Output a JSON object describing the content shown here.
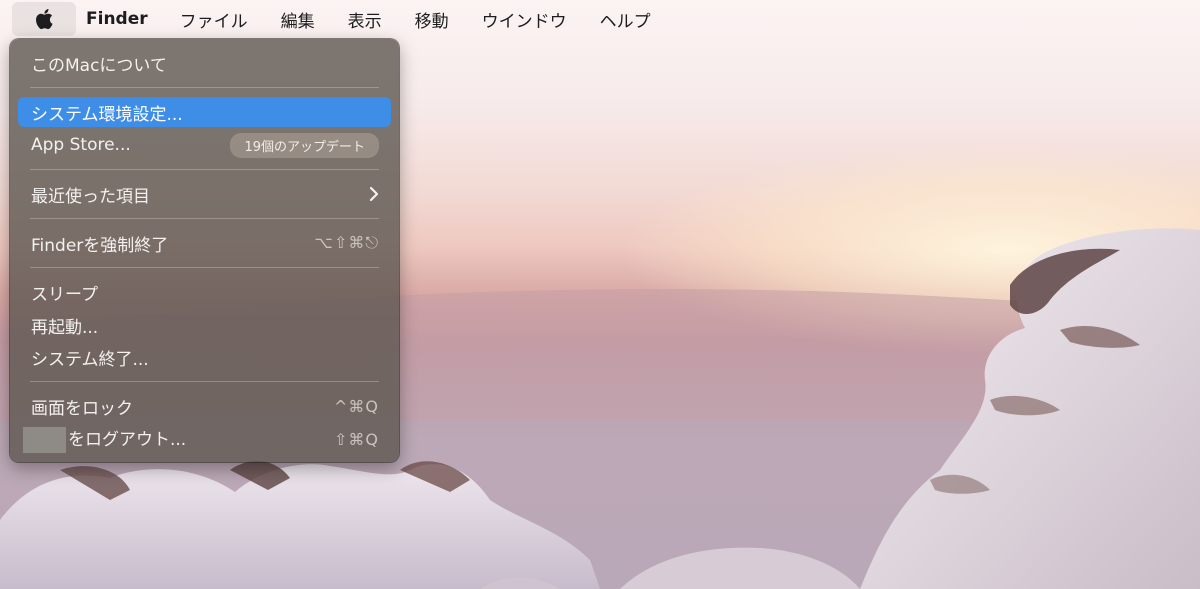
{
  "menubar": {
    "app_name": "Finder",
    "menus": [
      "ファイル",
      "編集",
      "表示",
      "移動",
      "ウインドウ",
      "ヘルプ"
    ]
  },
  "apple_menu": {
    "about": "このMacについて",
    "system_prefs": "システム環境設定...",
    "app_store": "App Store...",
    "app_store_badge": "19個のアップデート",
    "recent_items": "最近使った項目",
    "force_quit": "Finderを強制終了",
    "force_quit_shortcut": "⌥⇧⌘⎋",
    "sleep": "スリープ",
    "restart": "再起動...",
    "shutdown": "システム終了...",
    "lock_screen": "画面をロック",
    "lock_screen_shortcut": "^⌘Q",
    "logout": "をログアウト...",
    "logout_shortcut": "⇧⌘Q"
  },
  "colors": {
    "highlight": "#3e8ee8",
    "menu_bg": "#5c5650"
  }
}
